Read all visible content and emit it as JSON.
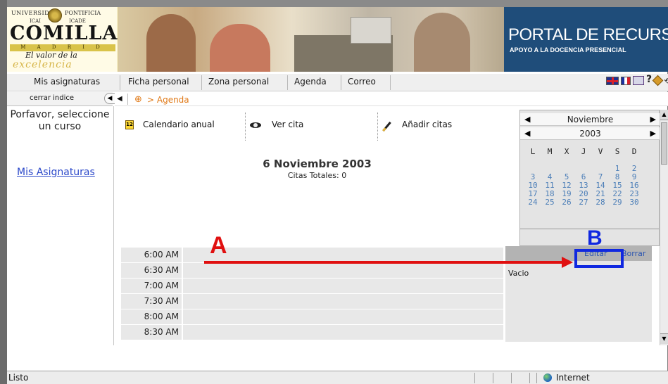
{
  "banner": {
    "uni_text": "UNIVERSIDAD",
    "pont_text": "PONTIFICIA",
    "icai": "ICAI",
    "icade": "ICADE",
    "comillas": "COMILLAS",
    "madrid": "M A D R I D",
    "motto": "El valor de la",
    "excelencia": "excelencia",
    "portal_title": "PORTAL DE RECURSOS",
    "portal_subtitle": "APOYO A LA DOCENCIA PRESENCIAL"
  },
  "nav": {
    "items": [
      "Mis asignaturas",
      "Ficha personal",
      "Zona personal",
      "Agenda",
      "Correo"
    ]
  },
  "sidebar": {
    "toggle_label": "cerrar indice",
    "message": "Porfavor, seleccione un curso",
    "link": "Mis Asignaturas"
  },
  "breadcrumb": {
    "label": "> Agenda"
  },
  "toolbar": {
    "calendar_label": "Calendario anual",
    "view_label": "Ver cita",
    "add_label": "Añadir citas"
  },
  "day": {
    "title": "6 Noviembre 2003",
    "subtitle": "Citas Totales: 0"
  },
  "calendar": {
    "month": "Noviembre",
    "year": "2003",
    "weekdays": [
      "L",
      "M",
      "X",
      "J",
      "V",
      "S",
      "D"
    ],
    "weeks": [
      [
        "",
        "",
        "",
        "",
        "",
        "1",
        "2"
      ],
      [
        "3",
        "4",
        "5",
        "6",
        "7",
        "8",
        "9"
      ],
      [
        "10",
        "11",
        "12",
        "13",
        "14",
        "15",
        "16"
      ],
      [
        "17",
        "18",
        "19",
        "20",
        "21",
        "22",
        "23"
      ],
      [
        "24",
        "25",
        "26",
        "27",
        "28",
        "29",
        "30"
      ]
    ]
  },
  "slots": [
    "6:00 AM",
    "6:30 AM",
    "7:00 AM",
    "7:30 AM",
    "8:00 AM",
    "8:30 AM"
  ],
  "detail": {
    "edit_label": "Editar",
    "delete_label": "Borrar",
    "empty_label": "Vacio"
  },
  "annotations": {
    "a": "A",
    "b": "B"
  },
  "status": {
    "text": "Listo",
    "zone": "Internet"
  },
  "colors": {
    "accent_orange": "#e07a18",
    "link_blue": "#2a47c9",
    "annotation_red": "#e01010",
    "annotation_blue": "#1028e0",
    "portal_blue": "#1f4d7a"
  }
}
